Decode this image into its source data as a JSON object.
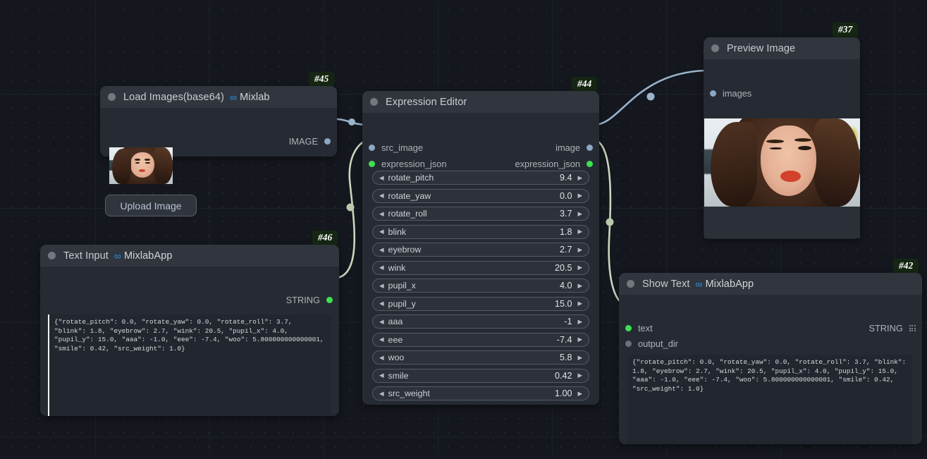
{
  "canvas": {
    "zoom_background": "#14171e"
  },
  "nodes": {
    "load_images": {
      "badge": "#45",
      "title": "Load Images(base64)",
      "suffix": "Mixlab",
      "infinity_icon": "infinity-icon",
      "outputs": [
        {
          "label": "IMAGE",
          "type": "image"
        }
      ],
      "upload_button": "Upload Image"
    },
    "text_input": {
      "badge": "#46",
      "title": "Text Input",
      "suffix": "MixlabApp",
      "infinity_icon": "infinity-icon",
      "outputs": [
        {
          "label": "STRING",
          "type": "string"
        }
      ],
      "text_value": "{\"rotate_pitch\": 0.0, \"rotate_yaw\": 0.0, \"rotate_roll\": 3.7, \"blink\": 1.8, \"eyebrow\": 2.7, \"wink\": 20.5, \"pupil_x\": 4.0, \"pupil_y\": 15.0, \"aaa\": -1.0, \"eee\": -7.4, \"woo\": 5.800000000000001, \"smile\": 0.42, \"src_weight\": 1.0}"
    },
    "expression_editor": {
      "badge": "#44",
      "title": "Expression Editor",
      "inputs": [
        {
          "label": "src_image",
          "type": "image"
        },
        {
          "label": "expression_json",
          "type": "string"
        }
      ],
      "outputs": [
        {
          "label": "image",
          "type": "image"
        },
        {
          "label": "expression_json",
          "type": "string"
        }
      ],
      "widgets": [
        {
          "name": "rotate_pitch",
          "value": "9.4"
        },
        {
          "name": "rotate_yaw",
          "value": "0.0"
        },
        {
          "name": "rotate_roll",
          "value": "3.7"
        },
        {
          "name": "blink",
          "value": "1.8"
        },
        {
          "name": "eyebrow",
          "value": "2.7"
        },
        {
          "name": "wink",
          "value": "20.5"
        },
        {
          "name": "pupil_x",
          "value": "4.0"
        },
        {
          "name": "pupil_y",
          "value": "15.0"
        },
        {
          "name": "aaa",
          "value": "-1"
        },
        {
          "name": "eee",
          "value": "-7.4"
        },
        {
          "name": "woo",
          "value": "5.8"
        },
        {
          "name": "smile",
          "value": "0.42"
        },
        {
          "name": "src_weight",
          "value": "1.00"
        }
      ],
      "left_arrow": "◀",
      "right_arrow": "▶"
    },
    "preview_image": {
      "badge": "#37",
      "title": "Preview Image",
      "inputs": [
        {
          "label": "images",
          "type": "image"
        }
      ]
    },
    "show_text": {
      "badge": "#42",
      "title": "Show Text",
      "suffix": "MixlabApp",
      "infinity_icon": "infinity-icon",
      "inputs": [
        {
          "label": "text",
          "type": "string"
        },
        {
          "label": "output_dir",
          "type": "gray"
        }
      ],
      "outputs": [
        {
          "label": "STRING",
          "type": "string",
          "icon": "grid-dots-icon"
        }
      ],
      "text_value": "{\"rotate_pitch\": 0.0, \"rotate_yaw\": 0.0, \"rotate_roll\": 3.7, \"blink\": 1.8, \"eyebrow\": 2.7, \"wink\": 20.5, \"pupil_x\": 4.0, \"pupil_y\": 15.0, \"aaa\": -1.0, \"eee\": -7.4, \"woo\": 5.800000000000001, \"smile\": 0.42, \"src_weight\": 1.0}"
    }
  },
  "colors": {
    "image_link": "#9ab4cc",
    "string_link": "#c4d4b4",
    "image_slot": "#8ca7c4",
    "string_slot": "#3ee050",
    "badge_bg": "#152713",
    "node_bg": "#262b33",
    "node_title_bg": "#31353d"
  }
}
